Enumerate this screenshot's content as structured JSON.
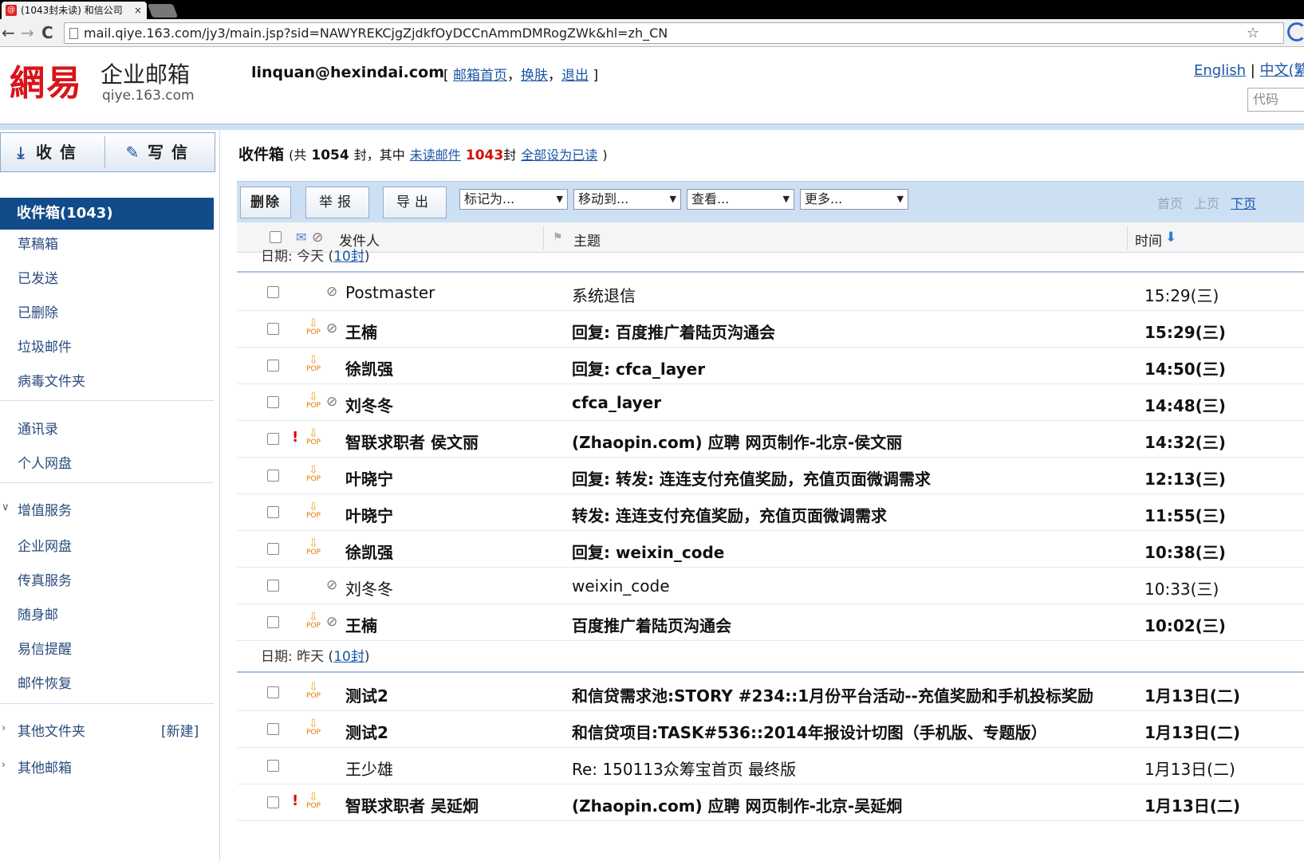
{
  "browser": {
    "tab_title": "(1043封未读) 和信公司",
    "tab_close": "×",
    "url": "mail.qiye.163.com/jy3/main.jsp?sid=NAWYREKCjgZjdkfOyDCCnAmmDMRogZWk&hl=zh_CN",
    "back": "←",
    "forward": "→",
    "reload": "C",
    "star": "☆"
  },
  "header": {
    "logo_cn": "網易",
    "logo_product": "企业邮箱",
    "logo_domain": "qiye.163.com",
    "account": "linquan@hexindai.com",
    "links": [
      "邮箱首页",
      "换肤",
      "退出"
    ],
    "lang_en": "English",
    "lang_cn": "中文(繁",
    "code_placeholder": "代码"
  },
  "sidebar": {
    "receive": "收信",
    "compose": "写信",
    "active_folder": "收件箱(1043)",
    "folders": [
      "草稿箱",
      "已发送",
      "已删除",
      "垃圾邮件",
      "病毒文件夹"
    ],
    "tools": [
      "通讯录",
      "个人网盘"
    ],
    "value_added_title": "增值服务",
    "value_added": [
      "企业网盘",
      "传真服务",
      "随身邮",
      "易信提醒",
      "邮件恢复"
    ],
    "other_folders": "其他文件夹",
    "new_folder": "[新建]",
    "other_mailboxes": "其他邮箱"
  },
  "inbox": {
    "title": "收件箱",
    "total_prefix": "(共",
    "total": "1054",
    "total_suffix": "封，其中",
    "unread_link": "未读邮件",
    "unread_count": "1043",
    "unread_suffix": "封",
    "mark_all_read": "全部设为已读",
    "close_paren": ")"
  },
  "toolbar": {
    "delete": "删除",
    "report": "举报",
    "export": "导出",
    "mark_as": "标记为...",
    "move_to": "移动到...",
    "view": "查看...",
    "more": "更多...",
    "pager": [
      "首页",
      "上页",
      "下页"
    ]
  },
  "columns": {
    "from": "发件人",
    "subject": "主题",
    "time": "时间"
  },
  "groups": [
    {
      "label": "日期:",
      "day": "今天",
      "count_open": "(",
      "count": "10封",
      "count_close": ")"
    },
    {
      "label": "日期:",
      "day": "昨天",
      "count_open": "(",
      "count": "10封",
      "count_close": ")"
    }
  ],
  "emails": [
    {
      "from": "Postmaster",
      "subject": "系统退信",
      "time": "15:29(三)",
      "unread": false,
      "pop": false,
      "attach": true,
      "urgent": false
    },
    {
      "from": "王楠",
      "subject": "回复: 百度推广着陆页沟通会",
      "time": "15:29(三)",
      "unread": true,
      "pop": true,
      "attach": true,
      "urgent": false
    },
    {
      "from": "徐凯强",
      "subject": "回复: cfca_layer",
      "time": "14:50(三)",
      "unread": true,
      "pop": true,
      "attach": false,
      "urgent": false
    },
    {
      "from": "刘冬冬",
      "subject": "cfca_layer",
      "time": "14:48(三)",
      "unread": true,
      "pop": true,
      "attach": true,
      "urgent": false
    },
    {
      "from": "智联求职者 侯文丽",
      "subject": "(Zhaopin.com) 应聘 网页制作-北京-侯文丽",
      "time": "14:32(三)",
      "unread": true,
      "pop": true,
      "attach": false,
      "urgent": true
    },
    {
      "from": "叶晓宁",
      "subject": "回复: 转发: 连连支付充值奖励，充值页面微调需求",
      "time": "12:13(三)",
      "unread": true,
      "pop": true,
      "attach": false,
      "urgent": false
    },
    {
      "from": "叶晓宁",
      "subject": "转发: 连连支付充值奖励，充值页面微调需求",
      "time": "11:55(三)",
      "unread": true,
      "pop": true,
      "attach": false,
      "urgent": false
    },
    {
      "from": "徐凯强",
      "subject": "回复: weixin_code",
      "time": "10:38(三)",
      "unread": true,
      "pop": true,
      "attach": false,
      "urgent": false
    },
    {
      "from": "刘冬冬",
      "subject": "weixin_code",
      "time": "10:33(三)",
      "unread": false,
      "pop": false,
      "attach": true,
      "urgent": false
    },
    {
      "from": "王楠",
      "subject": "百度推广着陆页沟通会",
      "time": "10:02(三)",
      "unread": true,
      "pop": true,
      "attach": true,
      "urgent": false
    },
    {
      "from": "测试2",
      "subject": "和信贷需求池:STORY #234::1月份平台活动--充值奖励和手机投标奖励",
      "time": "1月13日(二)",
      "unread": true,
      "pop": true,
      "attach": false,
      "urgent": false
    },
    {
      "from": "测试2",
      "subject": "和信贷项目:TASK#536::2014年报设计切图（手机版、专题版）",
      "time": "1月13日(二)",
      "unread": true,
      "pop": true,
      "attach": false,
      "urgent": false
    },
    {
      "from": "王少雄",
      "subject": "Re: 150113众筹宝首页 最终版",
      "time": "1月13日(二)",
      "unread": false,
      "pop": false,
      "attach": false,
      "urgent": false
    },
    {
      "from": "智联求职者 吴延炯",
      "subject": "(Zhaopin.com) 应聘 网页制作-北京-吴延炯",
      "time": "1月13日(二)",
      "unread": true,
      "pop": true,
      "attach": false,
      "urgent": true
    }
  ],
  "pop_label": "POP",
  "attach_icon": "paperclip-icon",
  "urgent_mark": "!",
  "colors": {
    "accent": "#124b8a",
    "link": "#1a56a6",
    "unread_count": "#d0110a",
    "toolbar": "#cde0f3"
  }
}
